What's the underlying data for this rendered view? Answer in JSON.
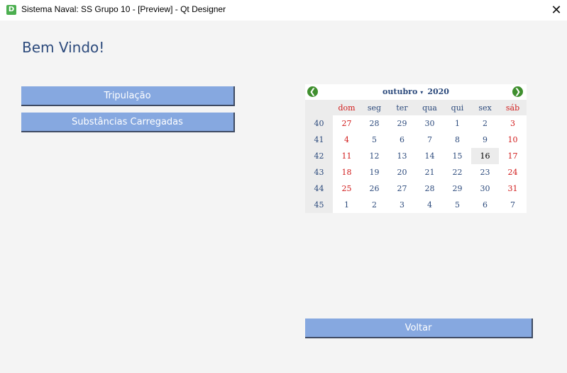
{
  "window": {
    "icon_letter": "D",
    "title": "Sistema Naval: SS Grupo 10 - [Preview] - Qt Designer",
    "close_glyph": "✕"
  },
  "main": {
    "welcome_text": "Bem Vindo!",
    "buttons": {
      "tripulacao": "Tripulação",
      "substancias": "Substâncias Carregadas",
      "voltar": "Voltar"
    }
  },
  "calendar": {
    "month": "outubro",
    "year": "2020",
    "prev_icon": "arrow-left-icon",
    "next_icon": "arrow-right-icon",
    "weekdays": [
      "dom",
      "seg",
      "ter",
      "qua",
      "qui",
      "sex",
      "sáb"
    ],
    "weeks": [
      {
        "week": "40",
        "days": [
          "27",
          "28",
          "29",
          "30",
          "1",
          "2",
          "3"
        ]
      },
      {
        "week": "41",
        "days": [
          "4",
          "5",
          "6",
          "7",
          "8",
          "9",
          "10"
        ]
      },
      {
        "week": "42",
        "days": [
          "11",
          "12",
          "13",
          "14",
          "15",
          "16",
          "17"
        ]
      },
      {
        "week": "43",
        "days": [
          "18",
          "19",
          "20",
          "21",
          "22",
          "23",
          "24"
        ]
      },
      {
        "week": "44",
        "days": [
          "25",
          "26",
          "27",
          "28",
          "29",
          "30",
          "31"
        ]
      },
      {
        "week": "45",
        "days": [
          "1",
          "2",
          "3",
          "4",
          "5",
          "6",
          "7"
        ]
      }
    ],
    "selected_day": "16",
    "colors": {
      "weekday_text": "#2c4a7c",
      "weekend_text": "#d11a1a",
      "nav_arrow": "#3f8f2e"
    }
  },
  "colors": {
    "button_bg": "#86a8e0",
    "title_text": "#2c4a7c",
    "background": "#f4f4f4"
  }
}
